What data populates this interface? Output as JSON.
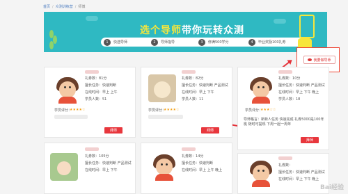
{
  "breadcrumb": {
    "home": "首页",
    "section": "众测训练营",
    "current": "师傅"
  },
  "banner": {
    "title_yellow": "选个导师",
    "title_white": "带你玩转众测",
    "steps": [
      {
        "num": "1",
        "label": "快选导师"
      },
      {
        "num": "2",
        "label": "导师指导"
      },
      {
        "num": "3",
        "label": "修满500学分"
      },
      {
        "num": "4",
        "label": "毕业奖励100礼券"
      }
    ]
  },
  "apply_button": "我要做导师",
  "cards": [
    {
      "lines": [
        "礼券数：",
        "擅长任务：快速判断",
        "在线时间：早上  上午",
        "学员人数：51"
      ],
      "count": "81分",
      "rating_label": "学员评分：",
      "stars": "★★★★☆",
      "action": "拜师"
    },
    {
      "lines": [
        "礼券数：",
        "擅长任务：快速判断 产品测试",
        "在线时间：早上  下午",
        "学员人数：11"
      ],
      "count": "82分",
      "rating_label": "学员评分：",
      "stars": "★★★★☆",
      "action": "拜师"
    },
    {
      "lines": [
        "礼券数：",
        "擅长任务：快速判断 产品测试",
        "在线时间：早上  下午  晚上",
        "学员人数：18"
      ],
      "count": "10分",
      "rating_label": "学员评分：",
      "stars": "★★★☆☆",
      "action": "拜师",
      "extra": "导师格言：新新人任务 快速完成 礼券5000是100年桃 随时可提现 下周一起一周年"
    },
    {
      "lines": [
        "礼券数：",
        "擅长任务：快速判断 产品测试",
        "在线时间：早上  下午"
      ],
      "count": "105分",
      "action": "拜师"
    },
    {
      "lines": [
        "礼券数：",
        "擅长任务：快速判断",
        "在线时间：早上  上午  晚上"
      ],
      "count": "14分",
      "action": "拜师"
    },
    {
      "lines": [
        "礼券数：",
        "擅长任务：快速判断 产品测试",
        "在线时间：早上  下午  晚上"
      ],
      "count": "",
      "action": "拜师"
    }
  ],
  "watermark": "Bai经验"
}
